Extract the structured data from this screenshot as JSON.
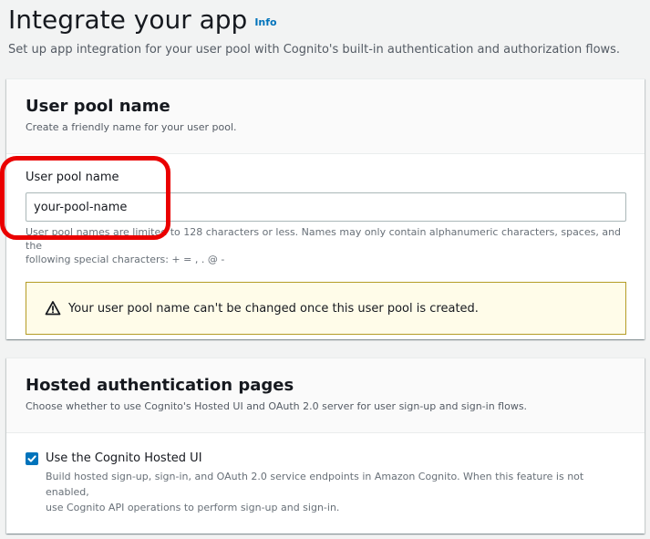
{
  "header": {
    "title": "Integrate your app",
    "info_link": "Info",
    "description": "Set up app integration for your user pool with Cognito's built-in authentication and authorization flows."
  },
  "user_pool_section": {
    "title": "User pool name",
    "description": "Create a friendly name for your user pool.",
    "field_label": "User pool name",
    "input_value": "your-pool-name",
    "constraint_line1": "User pool names are limited to 128 characters or less. Names may only contain alphanumeric characters, spaces, and the",
    "constraint_line2": "following special characters: + = , . @ -",
    "alert_text": "Your user pool name can't be changed once this user pool is created."
  },
  "hosted_auth_section": {
    "title": "Hosted authentication pages",
    "description": "Choose whether to use Cognito's Hosted UI and OAuth 2.0 server for user sign-up and sign-in flows.",
    "checkbox_label": "Use the Cognito Hosted UI",
    "checkbox_checked": true,
    "checkbox_desc_line1": "Build hosted sign-up, sign-in, and OAuth 2.0 service endpoints in Amazon Cognito. When this feature is not enabled,",
    "checkbox_desc_line2": "use Cognito API operations to perform sign-up and sign-in."
  },
  "colors": {
    "link": "#0073bb",
    "highlight": "#ea0000",
    "warning_bg": "#fffce9",
    "warning_border": "#b59c26",
    "checkbox": "#0073bb"
  },
  "icons": {
    "info": "info-link",
    "warning": "warning-icon",
    "checkbox": "checkmark-icon"
  }
}
